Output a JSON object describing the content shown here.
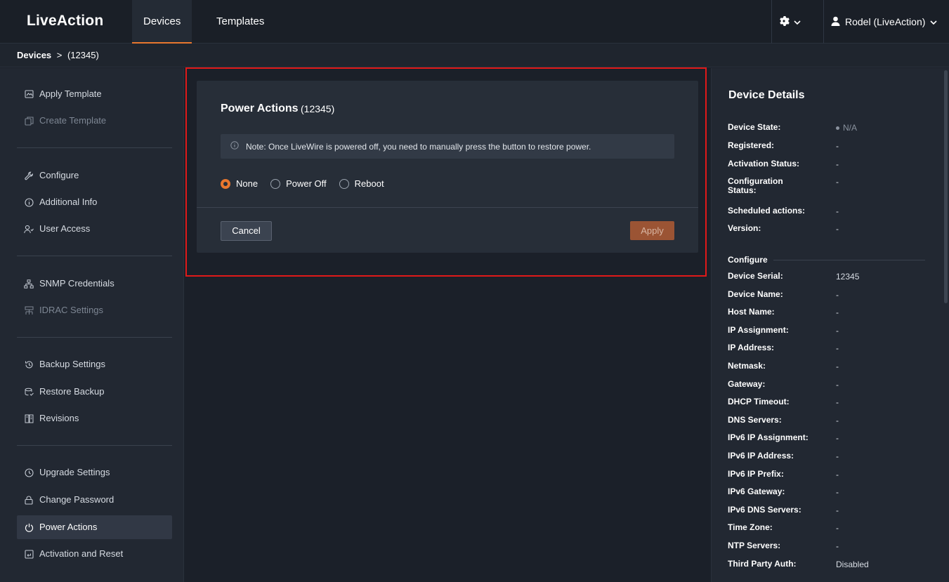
{
  "header": {
    "logo": "LiveAction",
    "tabs": [
      {
        "label": "Devices",
        "active": true
      },
      {
        "label": "Templates",
        "active": false
      }
    ],
    "user_label": "Rodel (LiveAction)",
    "accent_color": "#e8772e"
  },
  "breadcrumb": {
    "root": "Devices",
    "separator": ">",
    "current": "(12345)"
  },
  "sidebar": {
    "items": [
      {
        "label": "Apply Template",
        "icon": "template-icon",
        "disabled": false
      },
      {
        "label": "Create Template",
        "icon": "copy-icon",
        "disabled": true
      },
      {
        "label": "Configure",
        "icon": "wrench-icon",
        "disabled": false
      },
      {
        "label": "Additional Info",
        "icon": "info-icon",
        "disabled": false
      },
      {
        "label": "User Access",
        "icon": "user-access-icon",
        "disabled": false
      },
      {
        "label": "SNMP Credentials",
        "icon": "network-icon",
        "disabled": false
      },
      {
        "label": "IDRAC Settings",
        "icon": "server-icon",
        "disabled": true
      },
      {
        "label": "Backup Settings",
        "icon": "history-icon",
        "disabled": false
      },
      {
        "label": "Restore Backup",
        "icon": "restore-icon",
        "disabled": false
      },
      {
        "label": "Revisions",
        "icon": "revisions-icon",
        "disabled": false
      },
      {
        "label": "Upgrade Settings",
        "icon": "clock-icon",
        "disabled": false
      },
      {
        "label": "Change Password",
        "icon": "lock-icon",
        "disabled": false
      },
      {
        "label": "Power Actions",
        "icon": "power-icon",
        "disabled": false,
        "active": true
      },
      {
        "label": "Activation and Reset",
        "icon": "reset-icon",
        "disabled": false
      }
    ]
  },
  "power_panel": {
    "title": "Power Actions",
    "device": "(12345)",
    "note": "Note: Once LiveWire is powered off, you need to manually press the button to restore power.",
    "options": [
      {
        "label": "None",
        "checked": true
      },
      {
        "label": "Power Off",
        "checked": false
      },
      {
        "label": "Reboot",
        "checked": false
      }
    ],
    "cancel_label": "Cancel",
    "apply_label": "Apply"
  },
  "details": {
    "title": "Device Details",
    "status_rows": [
      {
        "label": "Device State:",
        "value": "N/A"
      },
      {
        "label": "Registered:",
        "value": "-"
      },
      {
        "label": "Activation Status:",
        "value": "-"
      },
      {
        "label": "Configuration Status:",
        "value": "-"
      },
      {
        "label": "Scheduled actions:",
        "value": "-"
      },
      {
        "label": "Version:",
        "value": "-"
      }
    ],
    "configure_heading": "Configure",
    "configure_rows": [
      {
        "label": "Device Serial:",
        "value": "12345"
      },
      {
        "label": "Device Name:",
        "value": "-"
      },
      {
        "label": "Host Name:",
        "value": "-"
      },
      {
        "label": "IP Assignment:",
        "value": "-"
      },
      {
        "label": "IP Address:",
        "value": "-"
      },
      {
        "label": "Netmask:",
        "value": "-"
      },
      {
        "label": "Gateway:",
        "value": "-"
      },
      {
        "label": "DHCP Timeout:",
        "value": "-"
      },
      {
        "label": "DNS Servers:",
        "value": "-"
      },
      {
        "label": "IPv6 IP Assignment:",
        "value": "-"
      },
      {
        "label": "IPv6 IP Address:",
        "value": "-"
      },
      {
        "label": "IPv6 IP Prefix:",
        "value": "-"
      },
      {
        "label": "IPv6 Gateway:",
        "value": "-"
      },
      {
        "label": "IPv6 DNS Servers:",
        "value": "-"
      },
      {
        "label": "Time Zone:",
        "value": "-"
      },
      {
        "label": "NTP Servers:",
        "value": "-"
      },
      {
        "label": "Third Party Auth:",
        "value": "Disabled"
      }
    ]
  }
}
